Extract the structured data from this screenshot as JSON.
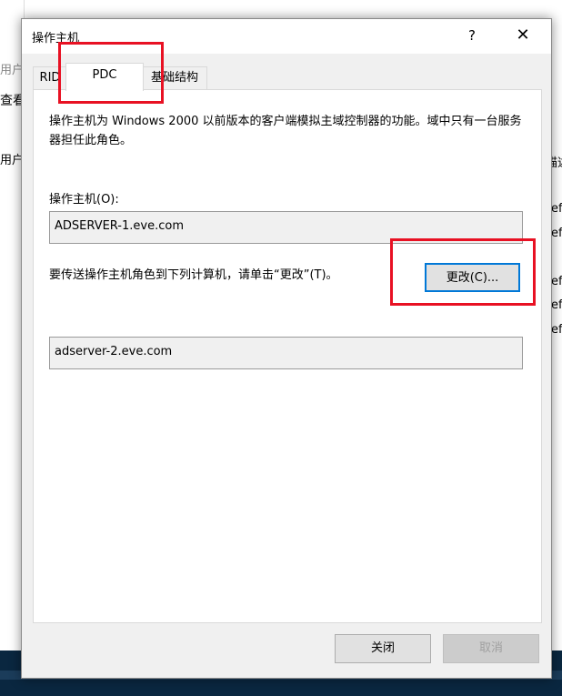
{
  "background": {
    "left_texts": [
      "用户",
      "查看",
      "用户"
    ],
    "right_texts": [
      "描述",
      "ef",
      "ef",
      "ef",
      "ef",
      "ef"
    ]
  },
  "dialog": {
    "title": "操作主机",
    "help_label": "?",
    "close_label": "✕",
    "tabs": [
      {
        "label": "RID",
        "selected": false
      },
      {
        "label": "PDC",
        "selected": true
      },
      {
        "label": "基础结构",
        "selected": false
      }
    ],
    "description": "操作主机为 Windows 2000 以前版本的客户端模拟主域控制器的功能。域中只有一台服务器担任此角色。",
    "operations_master_label": "操作主机(O):",
    "operations_master_value": "ADSERVER-1.eve.com",
    "transfer_instruction": "要传送操作主机角色到下列计算机，请单击“更改”(T)。",
    "change_button": "更改(C)...",
    "target_value": "adserver-2.eve.com",
    "close_button": "关闭",
    "cancel_button": "取消"
  },
  "colors": {
    "highlight": "#e81123",
    "focus_border": "#0078d7"
  }
}
